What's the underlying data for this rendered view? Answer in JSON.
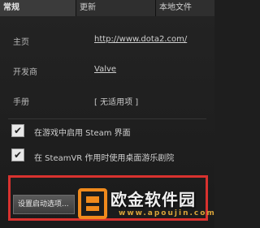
{
  "tabs": [
    {
      "label": "常规",
      "active": true
    },
    {
      "label": "更新",
      "active": false
    },
    {
      "label": "本地文件",
      "active": false
    }
  ],
  "info": {
    "homepage_label": "主页",
    "homepage_value": "http://www.dota2.com/",
    "developer_label": "开发商",
    "developer_value": "Valve",
    "manual_label": "手册",
    "manual_value": "[ 无适用项 ]"
  },
  "options": {
    "overlay_label": "在游戏中启用 Steam 界面",
    "overlay_checked": true,
    "theater_label": "在 SteamVR 作用时使用桌面游乐剧院",
    "theater_checked": true
  },
  "button": {
    "label": "设置启动选项..."
  },
  "watermark": {
    "text": "欧金软件园",
    "url": "www.apoujin.com"
  },
  "colors": {
    "highlight": "#d8322f",
    "watermark_orange": "#f08a1c"
  }
}
